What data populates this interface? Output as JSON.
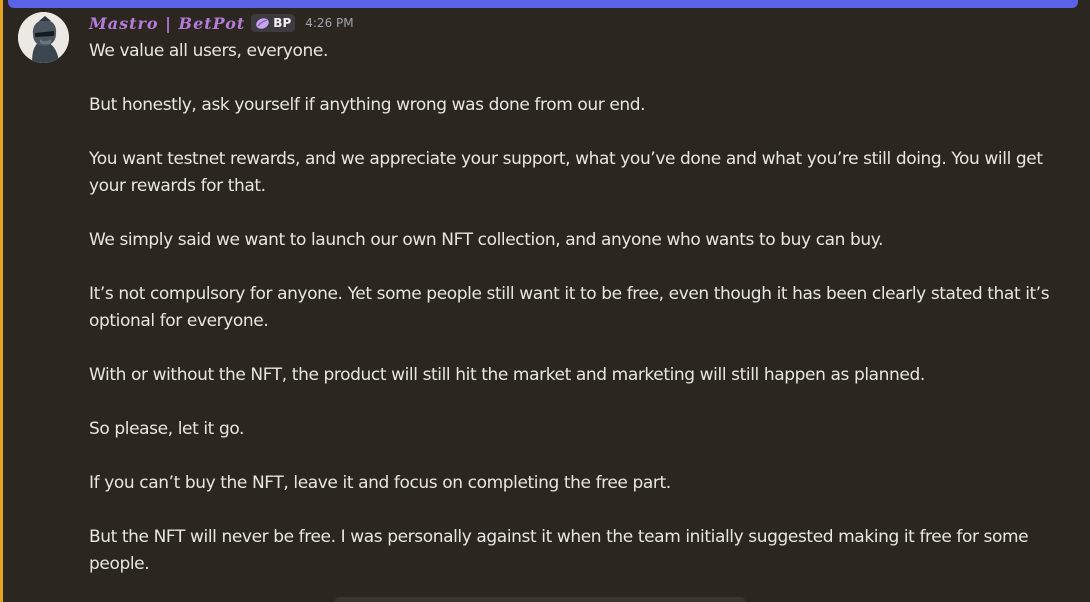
{
  "message": {
    "author": "Mastro | BetPot",
    "role_tag": "BP",
    "timestamp": "4:26 PM",
    "paragraphs": [
      "We value all users, everyone.",
      "But honestly, ask yourself if anything wrong was done from our end.",
      "You want testnet rewards, and we appreciate your support, what you’ve done and what you’re still doing. You will get your rewards for that.",
      "We simply said we want to launch our own NFT collection, and anyone who wants to buy can buy.",
      "It’s not compulsory for anyone. Yet some people still want it to be free, even though it has been clearly stated that it’s optional for everyone.",
      "With or without the NFT, the product will still hit the market and marketing will still happen as planned.",
      "So please, let it go.",
      "If you can’t buy the NFT, leave it and focus on completing the free part.",
      "But the NFT will never be free. I was personally against it when the team initially suggested making it free for some people."
    ],
    "avatar_icon": "ape-avatar-icon",
    "role_icon": "purple-pill-icon"
  },
  "colors": {
    "background": "#2b2620",
    "username": "#b57bd9",
    "text": "#e8e6e3",
    "timestamp": "#a0a4ab",
    "accent_bar": "#5a63e8",
    "highlight_edge": "#e3a51f"
  }
}
